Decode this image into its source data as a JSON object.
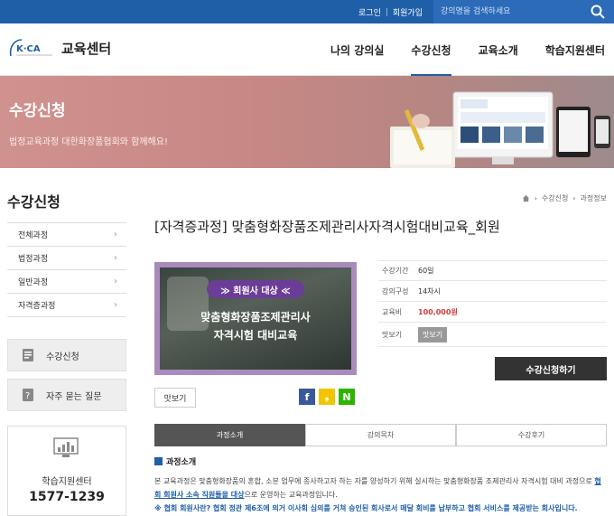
{
  "topbar": {
    "login": "로그인",
    "join": "회원가입",
    "search_placeholder": "강의명을 검색하세요"
  },
  "header": {
    "logo_text": "K·CA",
    "site_title": "교육센터",
    "nav": [
      "나의 강의실",
      "수강신청",
      "교육소개",
      "학습지원센터"
    ],
    "active_nav": "수강신청"
  },
  "banner": {
    "title": "수강신청",
    "subtitle": "법정교육과정 대한화장품협회와 함께해요!"
  },
  "sidebar": {
    "title": "수강신청",
    "menu": [
      "전체과정",
      "법정과정",
      "일반과정",
      "자격증과정"
    ],
    "quick": [
      "수강신청",
      "자주 묻는 질문"
    ],
    "support_label": "학습지원센터",
    "support_phone": "1577-1239"
  },
  "breadcrumb": [
    "수강신청",
    "과정정보"
  ],
  "course": {
    "title": "[자격증과정] 맞춤형화장품조제관리사자격시험대비교육_회원",
    "thumb_pill": "≫ 회원사 대상 ≪",
    "thumb_line1": "맞춤형화장품조제관리사",
    "thumb_line2": "자격시험 대비교육",
    "info": [
      {
        "key": "수강기간",
        "value": "60일"
      },
      {
        "key": "강의구성",
        "value": "14차시"
      },
      {
        "key": "교육비",
        "value": "100,000원"
      },
      {
        "key": "맛보기",
        "value": "맛보기"
      }
    ],
    "apply_button": "수강신청하기",
    "preview_button": "맛보기",
    "share": [
      "f",
      "❟",
      "N"
    ]
  },
  "tabs": [
    "과정소개",
    "강의목차",
    "수강후기"
  ],
  "active_tab": "과정소개",
  "section": {
    "heading": "과정소개",
    "para_a": "본 교육과정은 맞춤형화장품의 혼합, 소분 업무에 종사하고자 하는 자를 양성하기 위해 실시하는 맞춤형화장품 조제관리사 자격시험 대비 과정으로 ",
    "para_u": "협회 회원사 소속 직원들을 대상",
    "para_b": "으로 운영하는 교육과정입니다.",
    "note": "※ 협회 회원사란? 협회 정관 제6조에 의거 이사회 심의를 거쳐 승인된 회사로서 매달 회비를 납부하고 협회 서비스를 제공받는 회사입니다."
  },
  "colors": {
    "brand_blue": "#1f5fa8",
    "price_red": "#d63a3a",
    "banner_rose": "#c88885",
    "thumb_purple": "#a98bbb"
  }
}
